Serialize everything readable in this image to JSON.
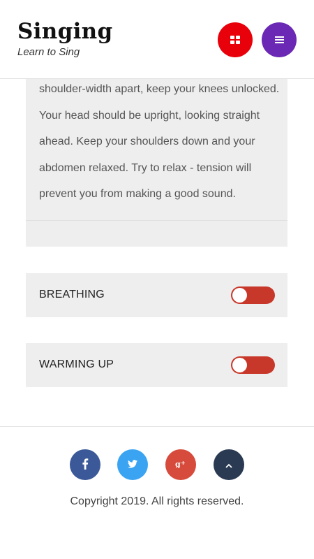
{
  "header": {
    "title": "Singing",
    "tagline": "Learn to Sing",
    "grid_icon": "grid-icon",
    "menu_icon": "hamburger-menu-icon"
  },
  "content": {
    "paragraph": "shoulder-width apart, keep your knees unlocked. Your head should be upright, looking straight ahead. Keep your shoulders down and your abdomen relaxed. Try to relax - tension will prevent you from making a good sound."
  },
  "sections": [
    {
      "label": "BREATHING",
      "expanded": false
    },
    {
      "label": "WARMING UP",
      "expanded": false
    }
  ],
  "footer": {
    "social": [
      {
        "name": "facebook",
        "glyph": "f",
        "color": "#3b5998"
      },
      {
        "name": "twitter",
        "glyph": "twitter-bird",
        "color": "#3aa4f2"
      },
      {
        "name": "google-plus",
        "glyph": "g+",
        "color": "#d64b3b"
      },
      {
        "name": "scroll-to-top",
        "glyph": "chevron-up",
        "color": "#2a3a53"
      }
    ],
    "copyright": "Copyright 2019. All rights reserved."
  },
  "colors": {
    "grid_button": "#e8000a",
    "menu_button": "#6a28b4",
    "toggle": "#c8382a",
    "panel_bg": "#eeeeee"
  }
}
